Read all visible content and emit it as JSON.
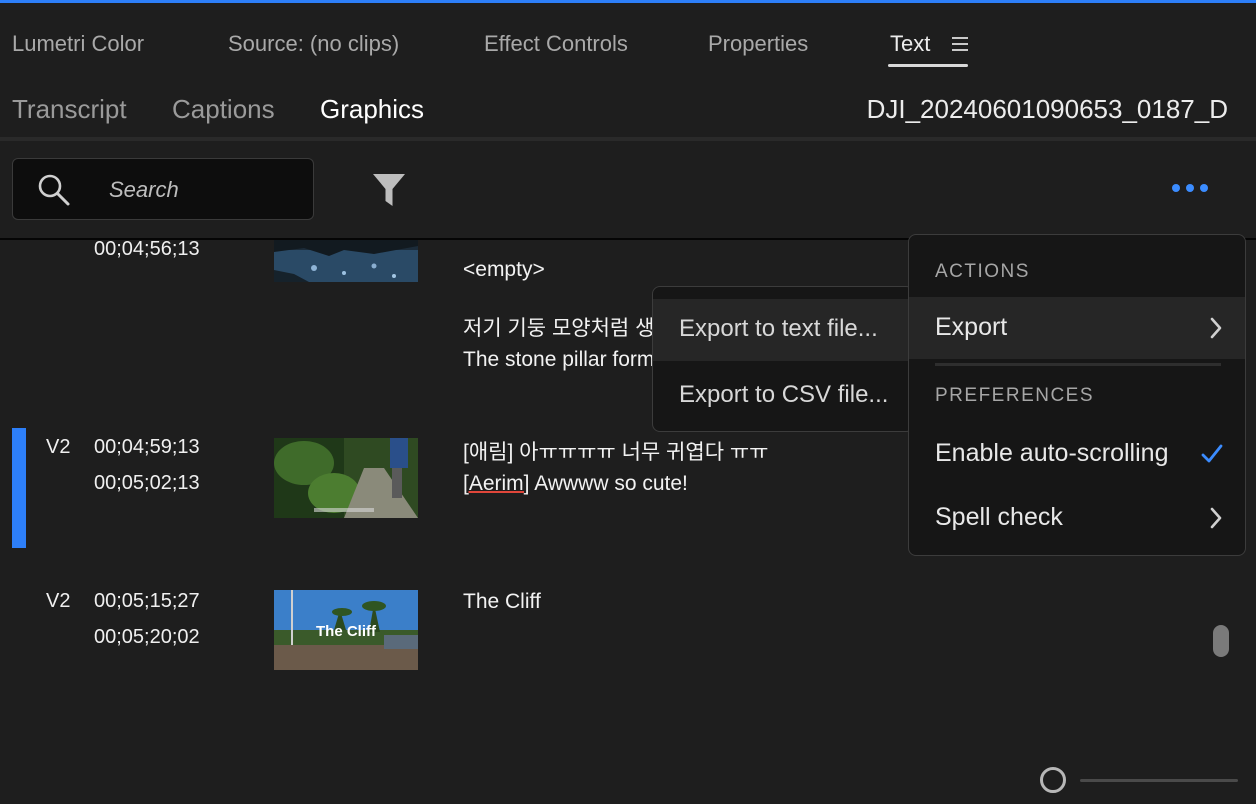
{
  "panel_tabs": [
    "Lumetri Color",
    "Source: (no clips)",
    "Effect Controls",
    "Properties",
    "Text"
  ],
  "sub_tabs": [
    "Transcript",
    "Captions",
    "Graphics"
  ],
  "clip_name": "DJI_20240601090653_0187_D",
  "search": {
    "placeholder": "Search"
  },
  "rows": [
    {
      "track": "",
      "tc_in": "00;04;56;13",
      "tc_out": "",
      "line1": "<empty>",
      "line2": "저기 기둥 모양처럼 생",
      "line3": "The stone pillar form"
    },
    {
      "track": "V2",
      "tc_in": "00;04;59;13",
      "tc_out": "00;05;02;13",
      "line1": "[애림] 아ㅠㅠㅠㅠ 너무 귀엽다 ㅠㅠ",
      "line2_word": "[Aerim]",
      "line2_rest": " Awwww so cute!"
    },
    {
      "track": "V2",
      "tc_in": "00;05;15;27",
      "tc_out": "00;05;20;02",
      "line1": "The Cliff",
      "thumb_overlay": "The Cliff"
    }
  ],
  "menu": {
    "section_actions": "ACTIONS",
    "export": "Export",
    "section_preferences": "PREFERENCES",
    "auto_scroll": "Enable auto-scrolling",
    "spell_check": "Spell check"
  },
  "submenu": {
    "export_text": "Export to text file...",
    "export_csv": "Export to CSV file..."
  },
  "colors": {
    "accent": "#2d7ff9",
    "background": "#1e1e1e",
    "menu_bg": "#161616"
  }
}
